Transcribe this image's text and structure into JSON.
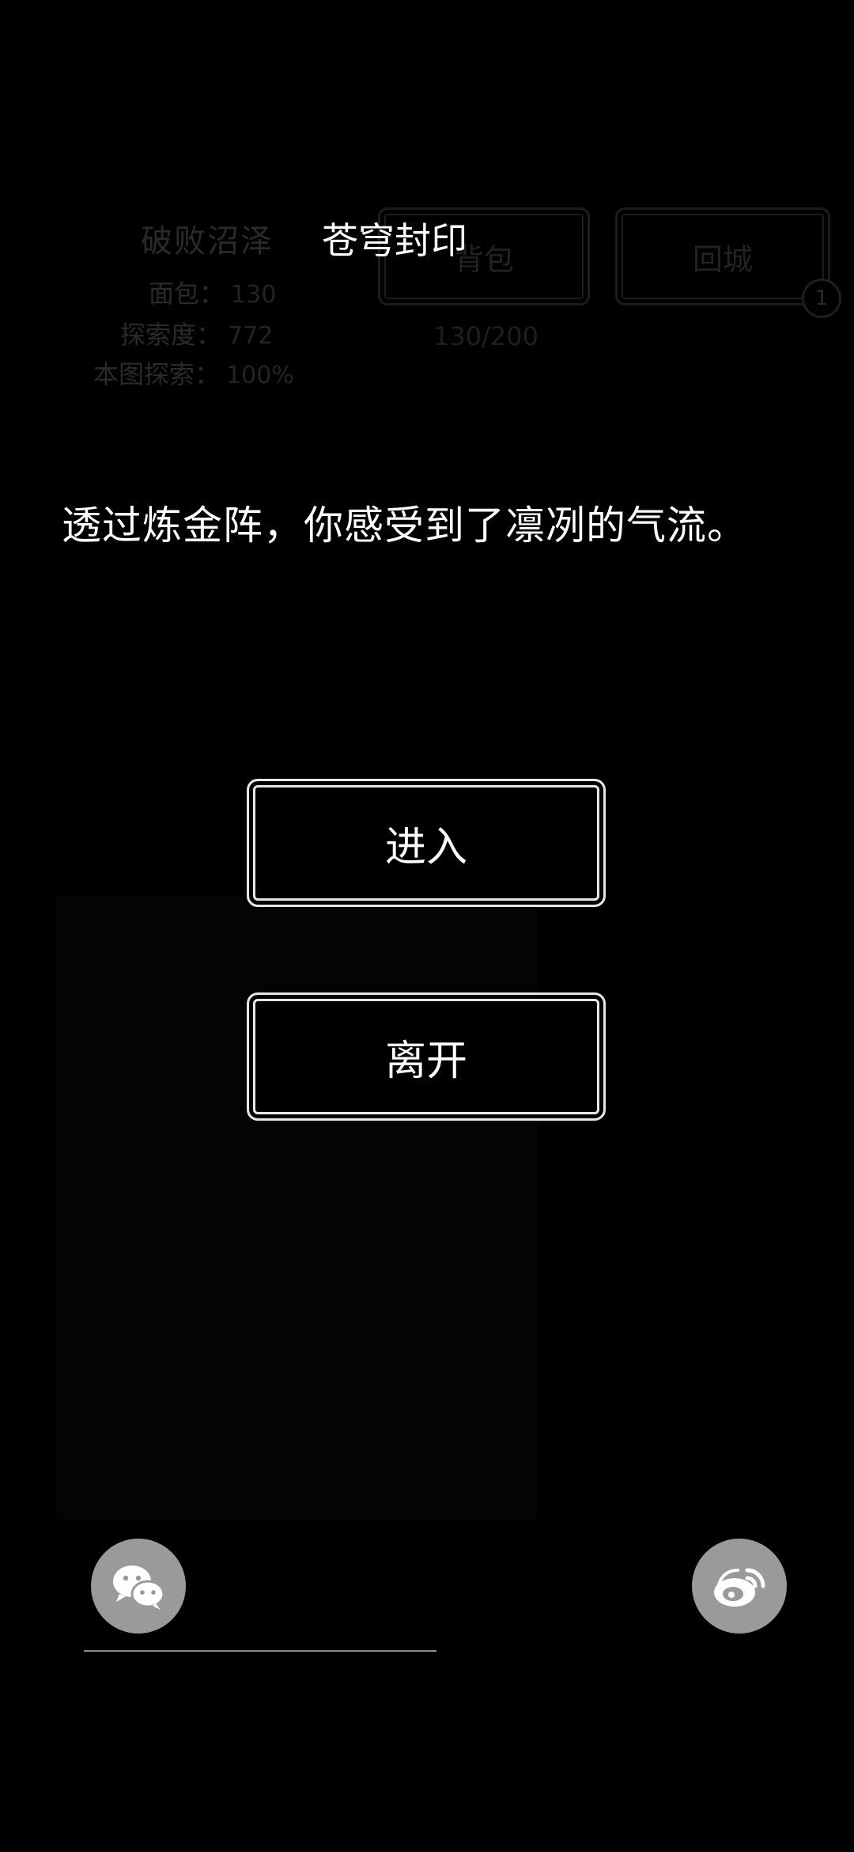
{
  "background": {
    "area_name": "破败沼泽",
    "stats": [
      {
        "label": "面包：",
        "value": "130"
      },
      {
        "label": "探索度：",
        "value": "772"
      },
      {
        "label": "本图探索：",
        "value": "100%"
      }
    ],
    "bag_button": "背包",
    "return_button": "回城",
    "return_badge": "1",
    "bag_capacity": "130/200"
  },
  "dialog": {
    "title": "苍穹封印",
    "message": "透过炼金阵，你感受到了凛冽的气流。",
    "enter_button": "进入",
    "leave_button": "离开"
  },
  "share": {
    "wechat_icon": "wechat-icon",
    "weibo_icon": "weibo-icon"
  },
  "colors": {
    "background": "#000000",
    "text": "#ffffff",
    "share_icon_bg": "#9a9a9a"
  }
}
